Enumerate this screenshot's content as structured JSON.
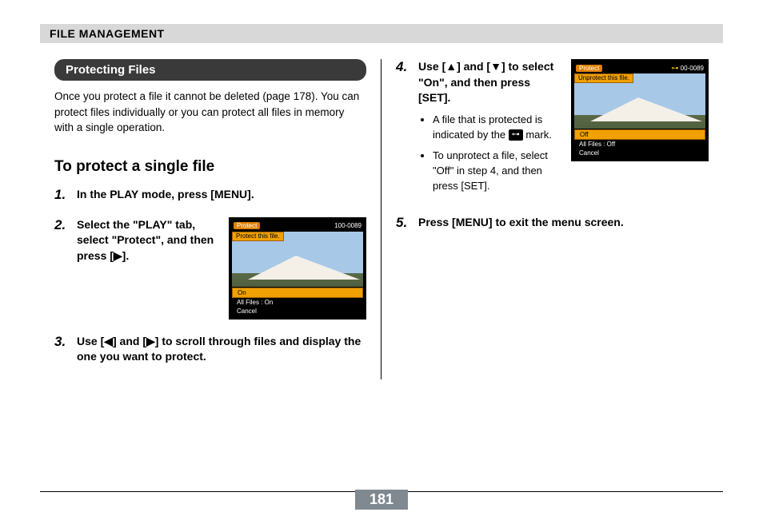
{
  "header": {
    "title": "FILE MANAGEMENT"
  },
  "subsection": {
    "title": "Protecting Files"
  },
  "intro": "Once you protect a file it cannot be deleted (page 178). You can protect files individually or you can protect all files in memory with a single operation.",
  "section_title": "To protect a single file",
  "steps": {
    "s1": {
      "num": "1.",
      "text": "In the PLAY mode, press [MENU]."
    },
    "s2": {
      "num": "2.",
      "text": "Select the \"PLAY\" tab, select \"Protect\", and then press [▶]."
    },
    "s3": {
      "num": "3.",
      "text": "Use [◀] and [▶] to scroll through files and display the one you want to protect."
    },
    "s4": {
      "num": "4.",
      "text": "Use [▲] and [▼] to select \"On\", and then press [SET].",
      "bullets": {
        "b1a": "A file that is protected is indicated by the ",
        "b1b": " mark.",
        "b2": "To unprotect a file, select \"Off\" in step 4, and then press [SET]."
      }
    },
    "s5": {
      "num": "5.",
      "text": "Press [MENU] to exit the menu screen."
    }
  },
  "lcd1": {
    "protect": "Protect",
    "file_no": "100-0089",
    "subbar": "Protect this file.",
    "menu": {
      "hl": "On",
      "row1": "All Files : On",
      "row2": "Cancel"
    }
  },
  "lcd2": {
    "protect": "Protect",
    "file_no": "00-0089",
    "subbar": "Unprotect this file.",
    "menu": {
      "hl": "Off",
      "row1": "All Files : Off",
      "row2": "Cancel"
    }
  },
  "icons": {
    "key": "⊶"
  },
  "page_number": "181"
}
